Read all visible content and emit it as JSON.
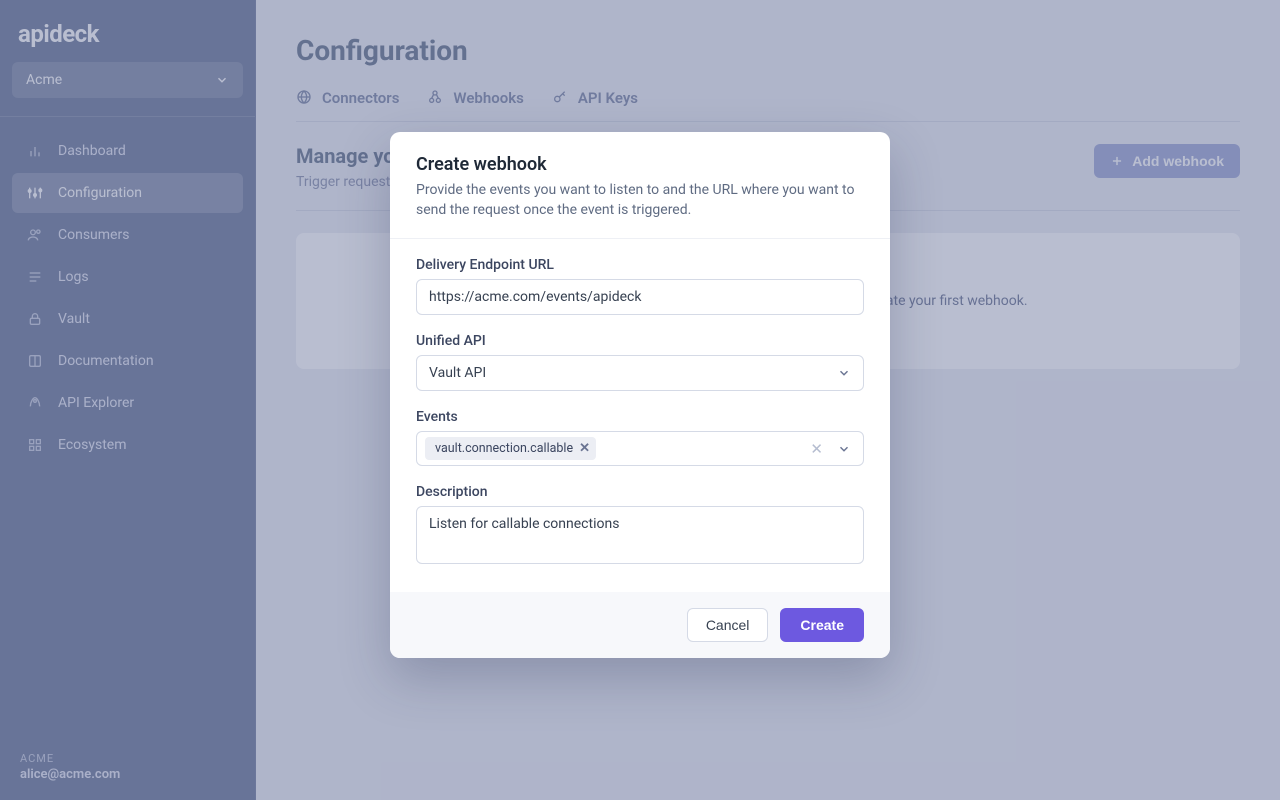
{
  "brand": "apideck",
  "org_selector": {
    "name": "Acme"
  },
  "sidebar": {
    "items": [
      {
        "label": "Dashboard"
      },
      {
        "label": "Configuration"
      },
      {
        "label": "Consumers"
      },
      {
        "label": "Logs"
      },
      {
        "label": "Vault"
      },
      {
        "label": "Documentation"
      },
      {
        "label": "API Explorer"
      },
      {
        "label": "Ecosystem"
      }
    ],
    "footer": {
      "account": "ACME",
      "email": "alice@acme.com"
    }
  },
  "page": {
    "title": "Configuration"
  },
  "tabs": [
    {
      "label": "Connectors"
    },
    {
      "label": "Webhooks"
    },
    {
      "label": "API Keys"
    }
  ],
  "section": {
    "title": "Manage your webhooks",
    "subtitle": "Trigger requests to your URL when events happen in Apideck.",
    "add_label": "Add webhook"
  },
  "empty_state": "You don't have any webhooks yet. Click \"Add webhook\" to create your first webhook.",
  "modal": {
    "title": "Create webhook",
    "subtitle": "Provide the events you want to listen to and the URL where you want to send the request once the event is triggered.",
    "fields": {
      "url_label": "Delivery Endpoint URL",
      "url_value": "https://acme.com/events/apideck",
      "api_label": "Unified API",
      "api_value": "Vault API",
      "events_label": "Events",
      "event_tags": [
        "vault.connection.callable"
      ],
      "description_label": "Description",
      "description_value": "Listen for callable connections"
    },
    "cancel_label": "Cancel",
    "create_label": "Create"
  }
}
